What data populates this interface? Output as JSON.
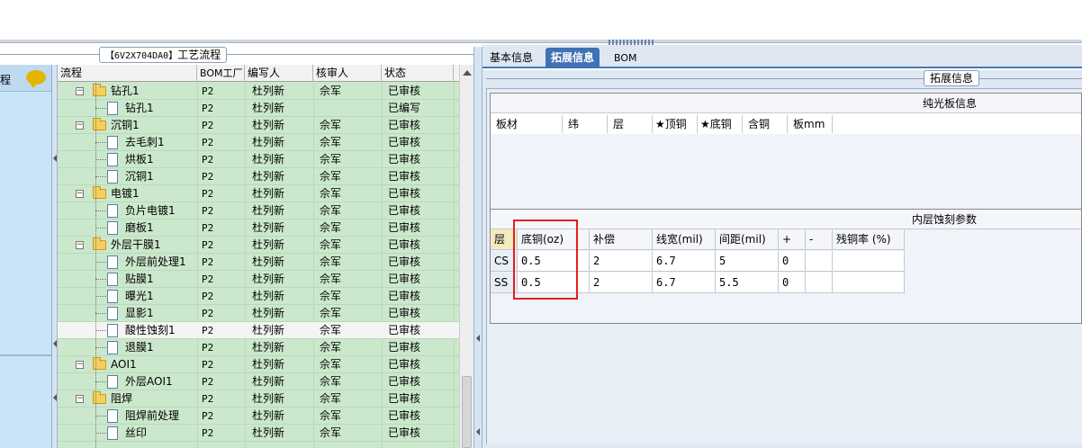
{
  "sidebar": {
    "label": "程"
  },
  "middle": {
    "title_code": "【6V2X704DA0】",
    "title_text": "工艺流程",
    "columns": [
      "流程",
      "BOM工厂",
      "编写人",
      "核审人",
      "状态"
    ],
    "rows": [
      {
        "name": "钻孔1",
        "level": 0,
        "type": "folder",
        "bom": "P2",
        "writer": "杜列新",
        "reviewer": "佘军",
        "status": "已审核"
      },
      {
        "name": "钻孔1",
        "level": 1,
        "type": "doc",
        "bom": "P2",
        "writer": "杜列新",
        "reviewer": "",
        "status": "已编写"
      },
      {
        "name": "沉铜1",
        "level": 0,
        "type": "folder",
        "bom": "P2",
        "writer": "杜列新",
        "reviewer": "佘军",
        "status": "已审核"
      },
      {
        "name": "去毛刺1",
        "level": 1,
        "type": "doc",
        "bom": "P2",
        "writer": "杜列新",
        "reviewer": "佘军",
        "status": "已审核"
      },
      {
        "name": "烘板1",
        "level": 1,
        "type": "doc",
        "bom": "P2",
        "writer": "杜列新",
        "reviewer": "佘军",
        "status": "已审核"
      },
      {
        "name": "沉铜1",
        "level": 1,
        "type": "doc",
        "bom": "P2",
        "writer": "杜列新",
        "reviewer": "佘军",
        "status": "已审核"
      },
      {
        "name": "电镀1",
        "level": 0,
        "type": "folder",
        "bom": "P2",
        "writer": "杜列新",
        "reviewer": "佘军",
        "status": "已审核"
      },
      {
        "name": "负片电镀1",
        "level": 1,
        "type": "doc",
        "bom": "P2",
        "writer": "杜列新",
        "reviewer": "佘军",
        "status": "已审核"
      },
      {
        "name": "磨板1",
        "level": 1,
        "type": "doc",
        "bom": "P2",
        "writer": "杜列新",
        "reviewer": "佘军",
        "status": "已审核"
      },
      {
        "name": "外层干膜1",
        "level": 0,
        "type": "folder",
        "bom": "P2",
        "writer": "杜列新",
        "reviewer": "佘军",
        "status": "已审核"
      },
      {
        "name": "外层前处理1",
        "level": 1,
        "type": "doc",
        "bom": "P2",
        "writer": "杜列新",
        "reviewer": "佘军",
        "status": "已审核"
      },
      {
        "name": "贴膜1",
        "level": 1,
        "type": "doc",
        "bom": "P2",
        "writer": "杜列新",
        "reviewer": "佘军",
        "status": "已审核"
      },
      {
        "name": "曝光1",
        "level": 1,
        "type": "doc",
        "bom": "P2",
        "writer": "杜列新",
        "reviewer": "佘军",
        "status": "已审核"
      },
      {
        "name": "显影1",
        "level": 1,
        "type": "doc",
        "bom": "P2",
        "writer": "杜列新",
        "reviewer": "佘军",
        "status": "已审核"
      },
      {
        "name": "酸性蚀刻1",
        "level": 1,
        "type": "doc",
        "bom": "P2",
        "writer": "杜列新",
        "reviewer": "佘军",
        "status": "已审核",
        "selected": true
      },
      {
        "name": "退膜1",
        "level": 1,
        "type": "doc",
        "bom": "P2",
        "writer": "杜列新",
        "reviewer": "佘军",
        "status": "已审核"
      },
      {
        "name": "AOI1",
        "level": 0,
        "type": "folder",
        "bom": "P2",
        "writer": "杜列新",
        "reviewer": "佘军",
        "status": "已审核"
      },
      {
        "name": "外层AOI1",
        "level": 1,
        "type": "doc",
        "bom": "P2",
        "writer": "杜列新",
        "reviewer": "佘军",
        "status": "已审核"
      },
      {
        "name": "阻焊",
        "level": 0,
        "type": "folder",
        "bom": "P2",
        "writer": "杜列新",
        "reviewer": "佘军",
        "status": "已审核"
      },
      {
        "name": "阻焊前处理",
        "level": 1,
        "type": "doc",
        "bom": "P2",
        "writer": "杜列新",
        "reviewer": "佘军",
        "status": "已审核"
      },
      {
        "name": "丝印",
        "level": 1,
        "type": "doc",
        "bom": "P2",
        "writer": "杜列新",
        "reviewer": "佘军",
        "status": "已审核"
      }
    ]
  },
  "tabs": [
    "基本信息",
    "拓展信息",
    "BOM"
  ],
  "active_tab": "拓展信息",
  "ext": {
    "title": "拓展信息",
    "board": {
      "title": "纯光板信息",
      "columns": [
        "板材",
        "纬",
        "层",
        "★顶铜",
        "★底铜",
        "含铜",
        "板mm"
      ]
    },
    "etch": {
      "title": "内层蚀刻参数",
      "columns": [
        "层",
        "底铜(oz)",
        "补偿",
        "线宽(mil)",
        "间距(mil)",
        "+",
        "-",
        "残铜率 (%)"
      ],
      "rows": [
        [
          "CS",
          "0.5",
          "2",
          "6.7",
          "5",
          "0",
          "",
          ""
        ],
        [
          "SS",
          "0.5",
          "2",
          "6.7",
          "5.5",
          "0",
          "",
          ""
        ]
      ]
    }
  },
  "colors": {
    "grid_bg": "#cce8cc",
    "accent": "#3f72b5",
    "highlight": "#e02020"
  }
}
